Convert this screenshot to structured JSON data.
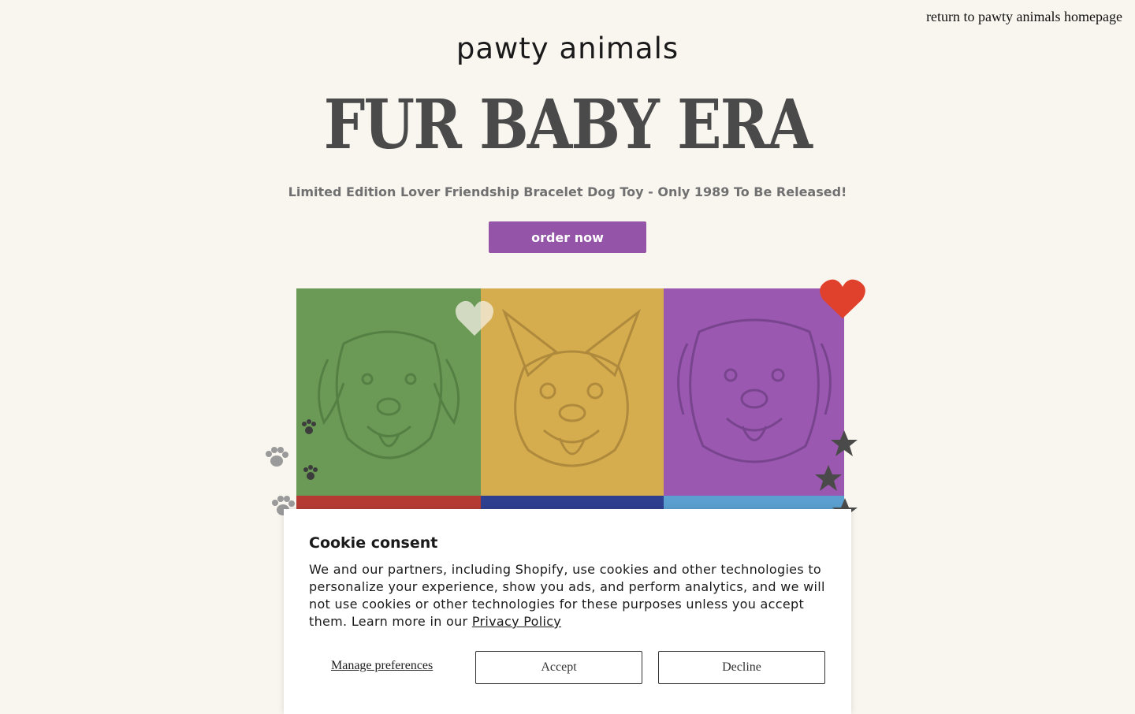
{
  "header": {
    "return_link": "return to pawty animals homepage",
    "logo_text": "pawty animals"
  },
  "hero": {
    "title": "FUR BABY ERA",
    "subtitle": "Limited Edition Lover Friendship Bracelet Dog Toy - Only 1989 To Be Released!",
    "cta_label": "order now",
    "panel_colors": [
      "#6b9a57",
      "#d6ad4e",
      "#9a58b0",
      "#b53b32",
      "#2e3f8f",
      "#5a9fd0"
    ]
  },
  "cookie_banner": {
    "title": "Cookie consent",
    "body": "We and our partners, including Shopify, use cookies and other technologies to personalize your experience, show you ads, and perform analytics, and we will not use cookies or other technologies for these purposes unless you accept them. Learn more in our",
    "policy_link": "Privacy Policy",
    "manage_label": "Manage preferences",
    "accept_label": "Accept",
    "decline_label": "Decline"
  },
  "colors": {
    "background": "#f9f5ef",
    "accent": "#9455a8",
    "heart": "#e0412c"
  }
}
